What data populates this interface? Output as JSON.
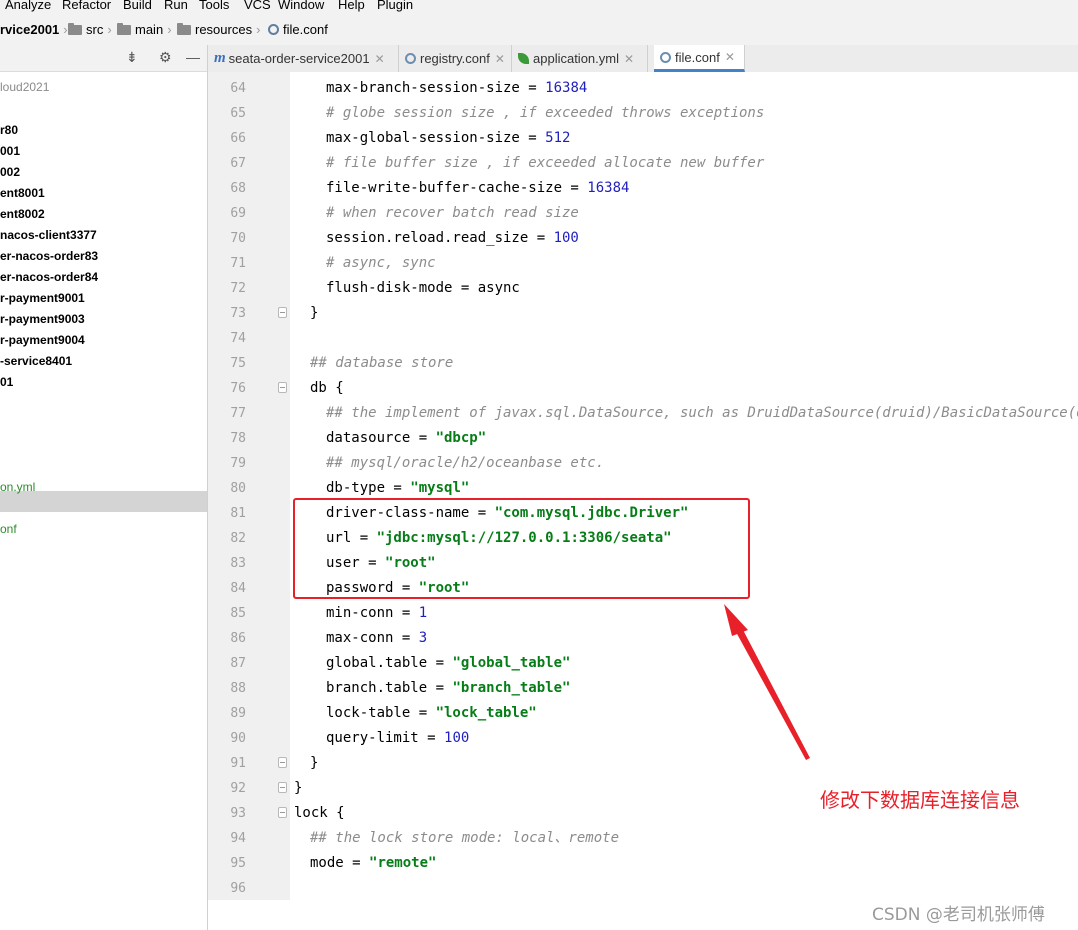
{
  "menu": [
    "Analyze",
    "Refactor",
    "Build",
    "Run",
    "Tools",
    "VCS",
    "Window",
    "Help",
    "Plugin"
  ],
  "breadcrumb": {
    "project": "rvice2001",
    "items": [
      "src",
      "main",
      "resources"
    ],
    "file": "file.conf"
  },
  "project_panel": {
    "items": [
      {
        "label": "loud2021",
        "style": "plain"
      },
      {
        "label": "r80",
        "style": "bold"
      },
      {
        "label": "001",
        "style": "bold"
      },
      {
        "label": "002",
        "style": "bold"
      },
      {
        "label": "ent8001",
        "style": "bold"
      },
      {
        "label": "ent8002",
        "style": "bold"
      },
      {
        "label": "nacos-client3377",
        "style": "bold"
      },
      {
        "label": "er-nacos-order83",
        "style": "bold"
      },
      {
        "label": "er-nacos-order84",
        "style": "bold"
      },
      {
        "label": "r-payment9001",
        "style": "bold"
      },
      {
        "label": "r-payment9003",
        "style": "bold"
      },
      {
        "label": "r-payment9004",
        "style": "bold"
      },
      {
        "label": "-service8401",
        "style": "bold"
      },
      {
        "label": "01",
        "style": "bold"
      },
      {
        "label": "on.yml",
        "style": "green"
      },
      {
        "label": "onf",
        "style": "green"
      }
    ]
  },
  "tabs": [
    {
      "label": "seata-order-service2001",
      "icon": "maven-icon",
      "active": false
    },
    {
      "label": "registry.conf",
      "icon": "config-file-icon",
      "active": false
    },
    {
      "label": "application.yml",
      "icon": "spring-leaf-icon",
      "active": false
    },
    {
      "label": "file.conf",
      "icon": "config-file-icon",
      "active": true
    }
  ],
  "code_lines": [
    {
      "n": "64",
      "indent": 2,
      "tokens": [
        [
          "t",
          "max-branch-session-size = "
        ],
        [
          "num",
          "16384"
        ]
      ]
    },
    {
      "n": "65",
      "indent": 2,
      "tokens": [
        [
          "cm",
          "# globe session size , if exceeded throws exceptions"
        ]
      ]
    },
    {
      "n": "66",
      "indent": 2,
      "tokens": [
        [
          "t",
          "max-global-session-size = "
        ],
        [
          "num",
          "512"
        ]
      ]
    },
    {
      "n": "67",
      "indent": 2,
      "tokens": [
        [
          "cm",
          "# file buffer size , if exceeded allocate new buffer"
        ]
      ]
    },
    {
      "n": "68",
      "indent": 2,
      "tokens": [
        [
          "t",
          "file-write-buffer-cache-size = "
        ],
        [
          "num",
          "16384"
        ]
      ]
    },
    {
      "n": "69",
      "indent": 2,
      "tokens": [
        [
          "cm",
          "# when recover batch read size"
        ]
      ]
    },
    {
      "n": "70",
      "indent": 2,
      "tokens": [
        [
          "t",
          "session.reload.read_size = "
        ],
        [
          "num",
          "100"
        ]
      ]
    },
    {
      "n": "71",
      "indent": 2,
      "tokens": [
        [
          "cm",
          "# async, sync"
        ]
      ]
    },
    {
      "n": "72",
      "indent": 2,
      "tokens": [
        [
          "t",
          "flush-disk-mode = async"
        ]
      ]
    },
    {
      "n": "73",
      "indent": 1,
      "fold": true,
      "tokens": [
        [
          "t",
          "}"
        ]
      ]
    },
    {
      "n": "74",
      "indent": 0,
      "tokens": []
    },
    {
      "n": "75",
      "indent": 1,
      "tokens": [
        [
          "cm",
          "## database store"
        ]
      ]
    },
    {
      "n": "76",
      "indent": 1,
      "fold": true,
      "tokens": [
        [
          "t",
          "db {"
        ]
      ]
    },
    {
      "n": "77",
      "indent": 2,
      "tokens": [
        [
          "cm",
          "## the implement of javax.sql.DataSource, such as DruidDataSource(druid)/BasicDataSource(dbcp)"
        ]
      ]
    },
    {
      "n": "78",
      "indent": 2,
      "tokens": [
        [
          "t",
          "datasource = "
        ],
        [
          "str",
          "\"dbcp\""
        ]
      ]
    },
    {
      "n": "79",
      "indent": 2,
      "tokens": [
        [
          "cm",
          "## mysql/oracle/h2/oceanbase etc."
        ]
      ]
    },
    {
      "n": "80",
      "indent": 2,
      "tokens": [
        [
          "t",
          "db-type = "
        ],
        [
          "str",
          "\"mysql\""
        ]
      ]
    },
    {
      "n": "81",
      "indent": 2,
      "tokens": [
        [
          "t",
          "driver-class-name = "
        ],
        [
          "str",
          "\"com.mysql.jdbc.Driver\""
        ]
      ]
    },
    {
      "n": "82",
      "indent": 2,
      "tokens": [
        [
          "t",
          "url = "
        ],
        [
          "str",
          "\"jdbc:mysql://127.0.0.1:3306/seata\""
        ]
      ]
    },
    {
      "n": "83",
      "indent": 2,
      "tokens": [
        [
          "t",
          "user = "
        ],
        [
          "str",
          "\"root\""
        ]
      ]
    },
    {
      "n": "84",
      "indent": 2,
      "tokens": [
        [
          "t",
          "password = "
        ],
        [
          "str",
          "\"root\""
        ]
      ]
    },
    {
      "n": "85",
      "indent": 2,
      "tokens": [
        [
          "t",
          "min-conn = "
        ],
        [
          "num",
          "1"
        ]
      ]
    },
    {
      "n": "86",
      "indent": 2,
      "tokens": [
        [
          "t",
          "max-conn = "
        ],
        [
          "num",
          "3"
        ]
      ]
    },
    {
      "n": "87",
      "indent": 2,
      "tokens": [
        [
          "t",
          "global.table = "
        ],
        [
          "str",
          "\"global_table\""
        ]
      ]
    },
    {
      "n": "88",
      "indent": 2,
      "tokens": [
        [
          "t",
          "branch.table = "
        ],
        [
          "str",
          "\"branch_table\""
        ]
      ]
    },
    {
      "n": "89",
      "indent": 2,
      "tokens": [
        [
          "t",
          "lock-table = "
        ],
        [
          "str",
          "\"lock_table\""
        ]
      ]
    },
    {
      "n": "90",
      "indent": 2,
      "tokens": [
        [
          "t",
          "query-limit = "
        ],
        [
          "num",
          "100"
        ]
      ]
    },
    {
      "n": "91",
      "indent": 1,
      "fold": true,
      "tokens": [
        [
          "t",
          "}"
        ]
      ]
    },
    {
      "n": "92",
      "indent": 0,
      "fold": true,
      "tokens": [
        [
          "t",
          "}"
        ]
      ]
    },
    {
      "n": "93",
      "indent": 0,
      "fold": true,
      "tokens": [
        [
          "t",
          "lock {"
        ]
      ]
    },
    {
      "n": "94",
      "indent": 1,
      "tokens": [
        [
          "cm",
          "## the lock store mode: local、remote"
        ]
      ]
    },
    {
      "n": "95",
      "indent": 1,
      "tokens": [
        [
          "t",
          "mode = "
        ],
        [
          "str",
          "\"remote\""
        ]
      ]
    },
    {
      "n": "96",
      "indent": 0,
      "tokens": []
    }
  ],
  "annotation": {
    "note": "修改下数据库连接信息",
    "color": "#e8202a"
  },
  "watermark": "CSDN @老司机张师傅"
}
